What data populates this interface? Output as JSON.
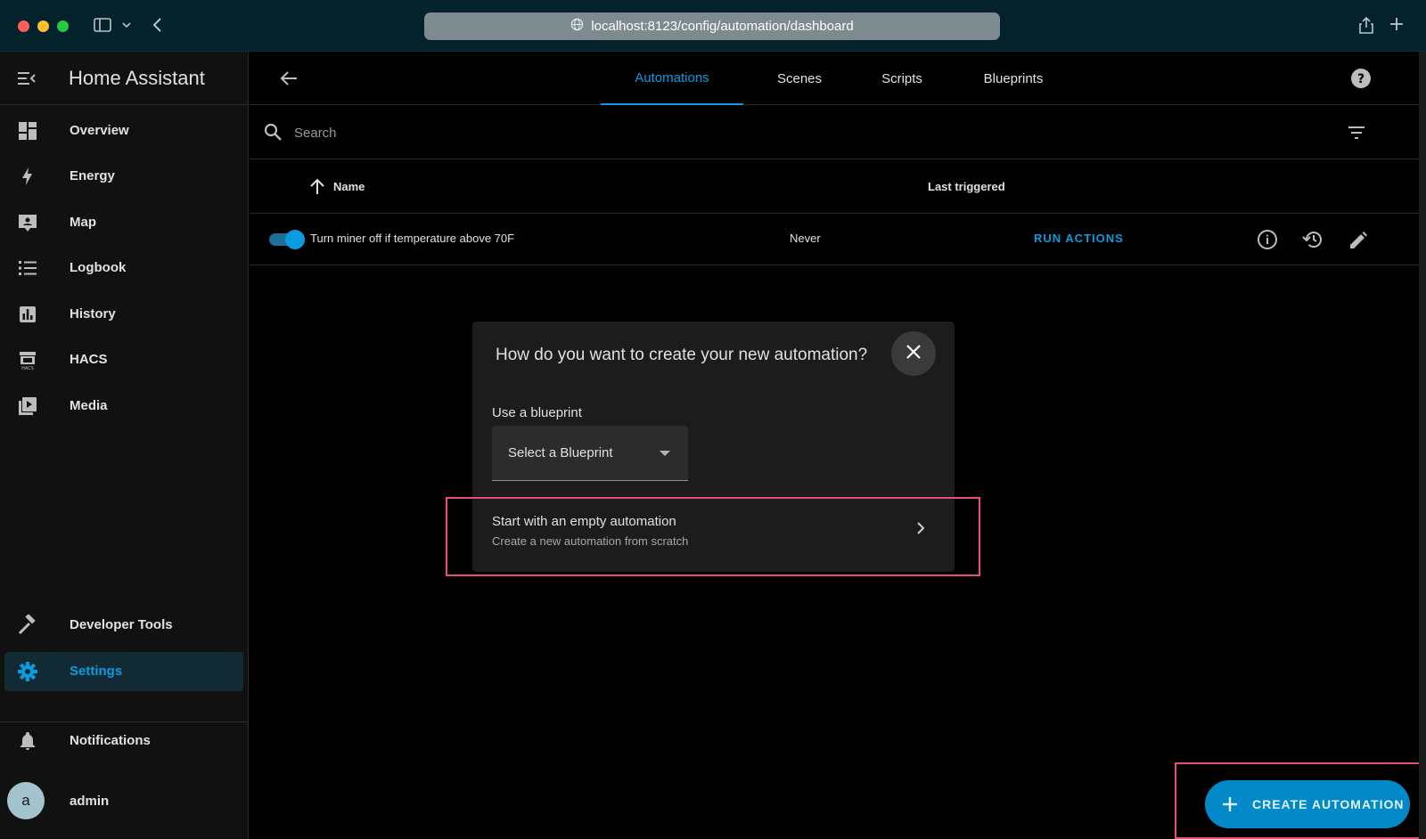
{
  "browser": {
    "url": "localhost:8123/config/automation/dashboard"
  },
  "sidebar": {
    "title": "Home Assistant",
    "items": [
      {
        "label": "Overview",
        "icon": "overview-icon"
      },
      {
        "label": "Energy",
        "icon": "lightning-icon"
      },
      {
        "label": "Map",
        "icon": "map-icon"
      },
      {
        "label": "Logbook",
        "icon": "logbook-icon"
      },
      {
        "label": "History",
        "icon": "history-chart-icon"
      },
      {
        "label": "HACS",
        "icon": "hacs-icon"
      },
      {
        "label": "Media",
        "icon": "media-icon"
      }
    ],
    "bottom_items": [
      {
        "label": "Developer Tools",
        "icon": "hammer-icon"
      },
      {
        "label": "Settings",
        "icon": "gear-icon",
        "active": true
      }
    ],
    "notifications_label": "Notifications",
    "user": {
      "avatar_letter": "a",
      "name": "admin"
    }
  },
  "topbar": {
    "tabs": [
      {
        "label": "Automations",
        "active": true
      },
      {
        "label": "Scenes"
      },
      {
        "label": "Scripts"
      },
      {
        "label": "Blueprints"
      }
    ]
  },
  "search": {
    "placeholder": "Search"
  },
  "table": {
    "columns": {
      "name": "Name",
      "last_triggered": "Last triggered"
    },
    "rows": [
      {
        "enabled": true,
        "name": "Turn miner off if temperature above 70F",
        "last_triggered": "Never",
        "action": "RUN ACTIONS"
      }
    ]
  },
  "dialog": {
    "title": "How do you want to create your new automation?",
    "blueprint_label": "Use a blueprint",
    "blueprint_select": "Select a Blueprint",
    "empty_title": "Start with an empty automation",
    "empty_subtitle": "Create a new automation from scratch"
  },
  "fab": {
    "label": "CREATE AUTOMATION"
  },
  "colors": {
    "accent": "#0b9be0",
    "highlight": "#ea4c77",
    "fab": "#0489c8"
  }
}
